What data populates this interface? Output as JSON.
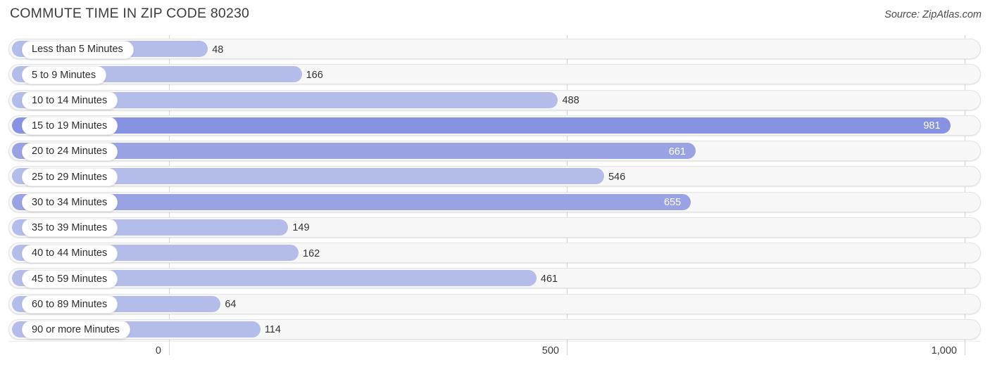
{
  "header": {
    "title": "COMMUTE TIME IN ZIP CODE 80230",
    "source": "Source: ZipAtlas.com"
  },
  "colors": {
    "bar_light": "#b4bdea",
    "bar_mid": "#99a3e4",
    "bar_dark": "#8793e2",
    "track": "#f7f7f7",
    "gridline": "#d8d8d8"
  },
  "chart_data": {
    "type": "bar",
    "orientation": "horizontal",
    "title": "COMMUTE TIME IN ZIP CODE 80230",
    "xlabel": "",
    "ylabel": "",
    "xlim": [
      0,
      1000
    ],
    "grid": true,
    "legend": "none",
    "xticks": [
      "0",
      "500",
      "1,000"
    ],
    "xtick_values": [
      0,
      500,
      1000
    ],
    "categories": [
      "Less than 5 Minutes",
      "5 to 9 Minutes",
      "10 to 14 Minutes",
      "15 to 19 Minutes",
      "20 to 24 Minutes",
      "25 to 29 Minutes",
      "30 to 34 Minutes",
      "35 to 39 Minutes",
      "40 to 44 Minutes",
      "45 to 59 Minutes",
      "60 to 89 Minutes",
      "90 or more Minutes"
    ],
    "values": [
      48,
      166,
      488,
      981,
      661,
      546,
      655,
      149,
      162,
      461,
      64,
      114
    ],
    "value_labels": [
      "48",
      "166",
      "488",
      "981",
      "661",
      "546",
      "655",
      "149",
      "162",
      "461",
      "64",
      "114"
    ],
    "label_placement": [
      "outside",
      "outside",
      "outside",
      "inside",
      "inside",
      "outside",
      "inside",
      "outside",
      "outside",
      "outside",
      "outside",
      "outside"
    ]
  }
}
